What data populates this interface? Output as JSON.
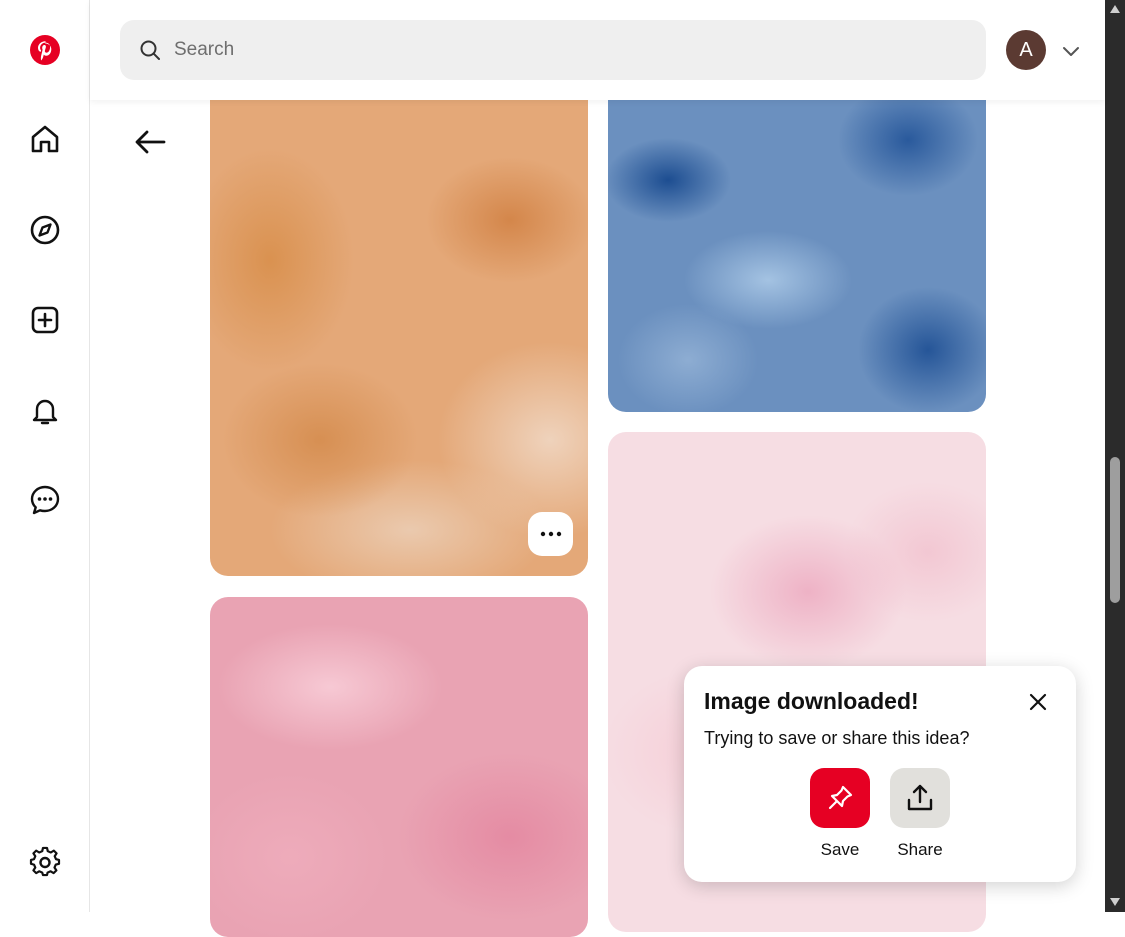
{
  "sidebar": {
    "logo": "pinterest-logo",
    "items": [
      {
        "name": "home",
        "icon": "home-icon"
      },
      {
        "name": "explore",
        "icon": "compass-icon"
      },
      {
        "name": "create",
        "icon": "plus-square-icon"
      },
      {
        "name": "notifications",
        "icon": "bell-icon"
      },
      {
        "name": "messages",
        "icon": "chat-icon"
      }
    ],
    "settings_icon": "gear-icon"
  },
  "header": {
    "search_placeholder": "Search",
    "avatar_initial": "A"
  },
  "toast": {
    "title": "Image downloaded!",
    "message": "Trying to save or share this idea?",
    "save_label": "Save",
    "share_label": "Share"
  },
  "colors": {
    "brand": "#e60023",
    "avatar": "#5b3a32",
    "search_bg": "#efefef"
  }
}
